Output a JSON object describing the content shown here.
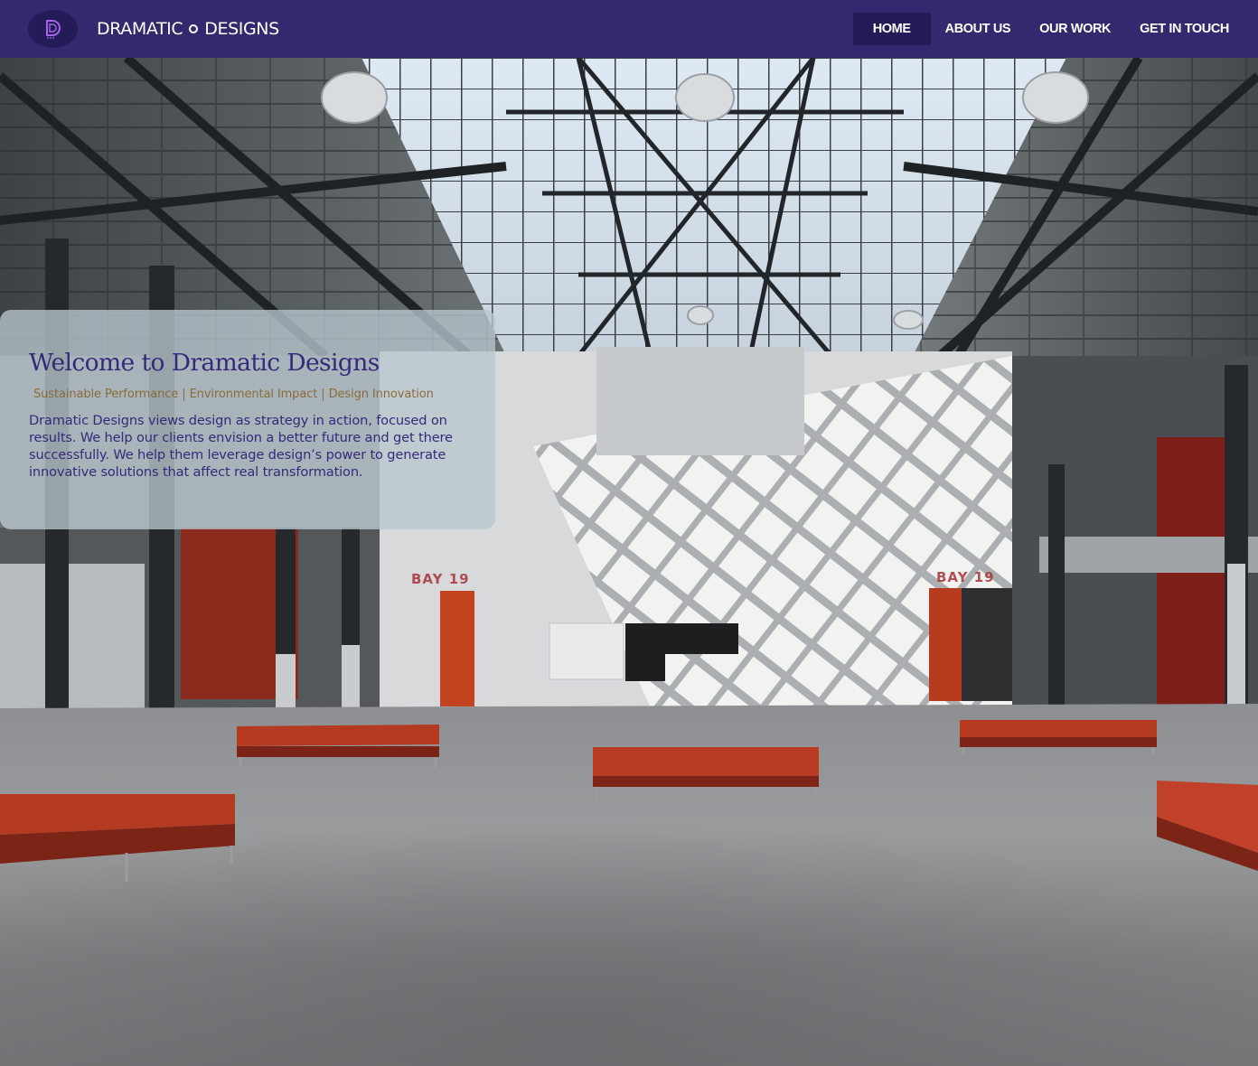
{
  "header": {
    "brand_left": "DRAMATIC",
    "brand_right": "DESIGNS",
    "logo_letter": "D",
    "nav": [
      {
        "label": "HOME",
        "active": true
      },
      {
        "label": "ABOUT US",
        "active": false
      },
      {
        "label": "OUR WORK",
        "active": false
      },
      {
        "label": "GET IN TOUCH",
        "active": false
      }
    ]
  },
  "hero": {
    "title": "Welcome to Dramatic Designs",
    "tagline": "Sustainable Performance | Environmental Impact | Design Innovation",
    "body": "Dramatic Designs views design as strategy in action, focused on results. We help our clients envision a better future and get there successfully. We help them leverage design’s power to generate innovative solutions that affect real transformation.",
    "bay_signs": [
      "BAY 19",
      "BAY 19"
    ]
  },
  "colors": {
    "header_bg": "#33296f",
    "active_nav_bg": "#241c59",
    "title": "#36297a",
    "tagline": "#8b6a3a",
    "bench_red": "#b23a26"
  }
}
